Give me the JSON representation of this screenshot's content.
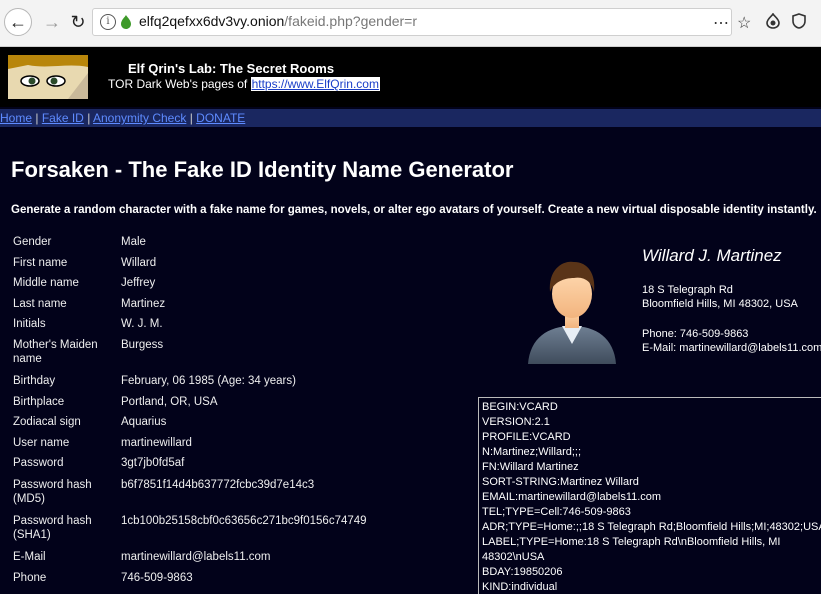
{
  "browser": {
    "url_domain": "elfq2qefxx6dv3vy.onion",
    "url_path": "/fakeid.php?gender=r",
    "icons": [
      "back-arrow-icon",
      "forward-arrow-icon",
      "reload-icon",
      "info-icon",
      "onion-icon",
      "more-icon",
      "star-icon",
      "tor-icon",
      "shield-icon"
    ]
  },
  "site": {
    "title": "Elf Qrin's Lab: The Secret Rooms",
    "subtitle_prefix": "TOR Dark Web's pages of ",
    "subtitle_link": "https://www.ElfQrin.com"
  },
  "nav": {
    "items": [
      "Home",
      "Fake ID",
      "Anonymity Check",
      "DONATE"
    ],
    "separator": "|"
  },
  "page": {
    "title": "Forsaken - The Fake ID Identity Name Generator",
    "intro": "Generate a random character with a fake name for games, novels, or alter ego avatars of yourself. Create a new virtual disposable identity instantly."
  },
  "identity_rows": [
    {
      "label": "Gender",
      "value": "Male"
    },
    {
      "label": "First name",
      "value": "Willard"
    },
    {
      "label": "Middle name",
      "value": "Jeffrey"
    },
    {
      "label": "Last name",
      "value": "Martinez"
    },
    {
      "label": "Initials",
      "value": "W. J. M."
    },
    {
      "label": "Mother's Maiden name",
      "value": "Burgess"
    },
    {
      "label": "Birthday",
      "value": "February, 06 1985 (Age: 34 years)"
    },
    {
      "label": "Birthplace",
      "value": "Portland, OR, USA"
    },
    {
      "label": "Zodiacal sign",
      "value": "Aquarius"
    },
    {
      "label": "User name",
      "value": "martinewillard"
    },
    {
      "label": "Password",
      "value": "3gt7jb0fd5af"
    },
    {
      "label": "Password hash (MD5)",
      "value": "b6f7851f14d4b637772fcbc39d7e14c3"
    },
    {
      "label": "Password hash (SHA1)",
      "value": "1cb100b25158cbf0c63656c271bc9f0156c74749"
    },
    {
      "label": "E-Mail",
      "value": "martinewillard@labels11.com"
    },
    {
      "label": "Phone",
      "value": "746-509-9863"
    }
  ],
  "card": {
    "name": "Willard J. Martinez",
    "address_line1": "18 S Telegraph Rd",
    "address_line2": "Bloomfield Hills, MI 48302, USA",
    "phone": "Phone: 746-509-9863",
    "email": "E-Mail: martinewillard@labels11.com"
  },
  "vcard_lines": [
    "BEGIN:VCARD",
    "VERSION:2.1",
    "PROFILE:VCARD",
    "N:Martinez;Willard;;;",
    "FN:Willard Martinez",
    "SORT-STRING:Martinez Willard",
    "EMAIL:martinewillard@labels11.com",
    "TEL;TYPE=Cell:746-509-9863",
    "ADR;TYPE=Home:;;18 S Telegraph Rd;Bloomfield Hills;MI;48302;USA",
    "LABEL;TYPE=Home:18 S Telegraph Rd\\nBloomfield Hills, MI 48302\\nUSA",
    "BDAY:19850206",
    "KIND:individual"
  ]
}
